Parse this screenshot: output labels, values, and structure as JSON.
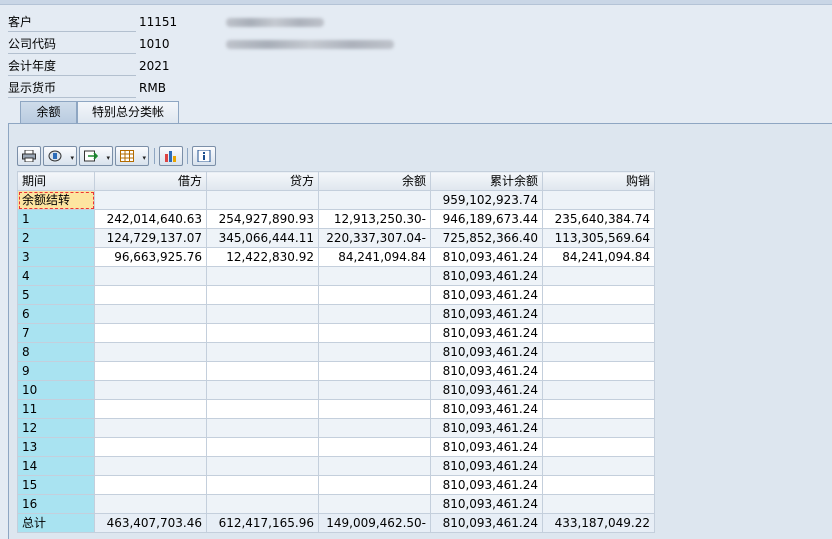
{
  "header": {
    "rows": [
      {
        "label": "客户",
        "value": "11151"
      },
      {
        "label": "公司代码",
        "value": "1010"
      },
      {
        "label": "会计年度",
        "value": "2021"
      },
      {
        "label": "显示货币",
        "value": "RMB"
      }
    ]
  },
  "tabs": [
    {
      "label": "余额",
      "active": true
    },
    {
      "label": "特别总分类帐",
      "active": false
    }
  ],
  "toolbar": {
    "buttons": [
      {
        "icon": "print-icon",
        "dropdown": false
      },
      {
        "icon": "filter-icon",
        "dropdown": true
      },
      {
        "icon": "export-icon",
        "dropdown": true
      },
      {
        "icon": "layout-icon",
        "dropdown": true
      },
      {
        "icon": "chart-icon",
        "dropdown": false
      },
      {
        "icon": "info-icon",
        "dropdown": false
      }
    ]
  },
  "table": {
    "columns": [
      "期间",
      "借方",
      "贷方",
      "余额",
      "累计余额",
      "购销"
    ],
    "rows": [
      [
        "余额结转",
        "",
        "",
        "",
        "959,102,923.74",
        ""
      ],
      [
        "1",
        "242,014,640.63",
        "254,927,890.93",
        "12,913,250.30-",
        "946,189,673.44",
        "235,640,384.74"
      ],
      [
        "2",
        "124,729,137.07",
        "345,066,444.11",
        "220,337,307.04-",
        "725,852,366.40",
        "113,305,569.64"
      ],
      [
        "3",
        "96,663,925.76",
        "12,422,830.92",
        "84,241,094.84",
        "810,093,461.24",
        "84,241,094.84"
      ],
      [
        "4",
        "",
        "",
        "",
        "810,093,461.24",
        ""
      ],
      [
        "5",
        "",
        "",
        "",
        "810,093,461.24",
        ""
      ],
      [
        "6",
        "",
        "",
        "",
        "810,093,461.24",
        ""
      ],
      [
        "7",
        "",
        "",
        "",
        "810,093,461.24",
        ""
      ],
      [
        "8",
        "",
        "",
        "",
        "810,093,461.24",
        ""
      ],
      [
        "9",
        "",
        "",
        "",
        "810,093,461.24",
        ""
      ],
      [
        "10",
        "",
        "",
        "",
        "810,093,461.24",
        ""
      ],
      [
        "11",
        "",
        "",
        "",
        "810,093,461.24",
        ""
      ],
      [
        "12",
        "",
        "",
        "",
        "810,093,461.24",
        ""
      ],
      [
        "13",
        "",
        "",
        "",
        "810,093,461.24",
        ""
      ],
      [
        "14",
        "",
        "",
        "",
        "810,093,461.24",
        ""
      ],
      [
        "15",
        "",
        "",
        "",
        "810,093,461.24",
        ""
      ],
      [
        "16",
        "",
        "",
        "",
        "810,093,461.24",
        ""
      ],
      [
        "总计",
        "463,407,703.46",
        "612,417,165.96",
        "149,009,462.50-",
        "810,093,461.24",
        "433,187,049.22"
      ]
    ]
  },
  "colors": {
    "key_column": "#a9e3f1",
    "selected_cell": "#fde5a0",
    "panel": "#dde6ef"
  }
}
